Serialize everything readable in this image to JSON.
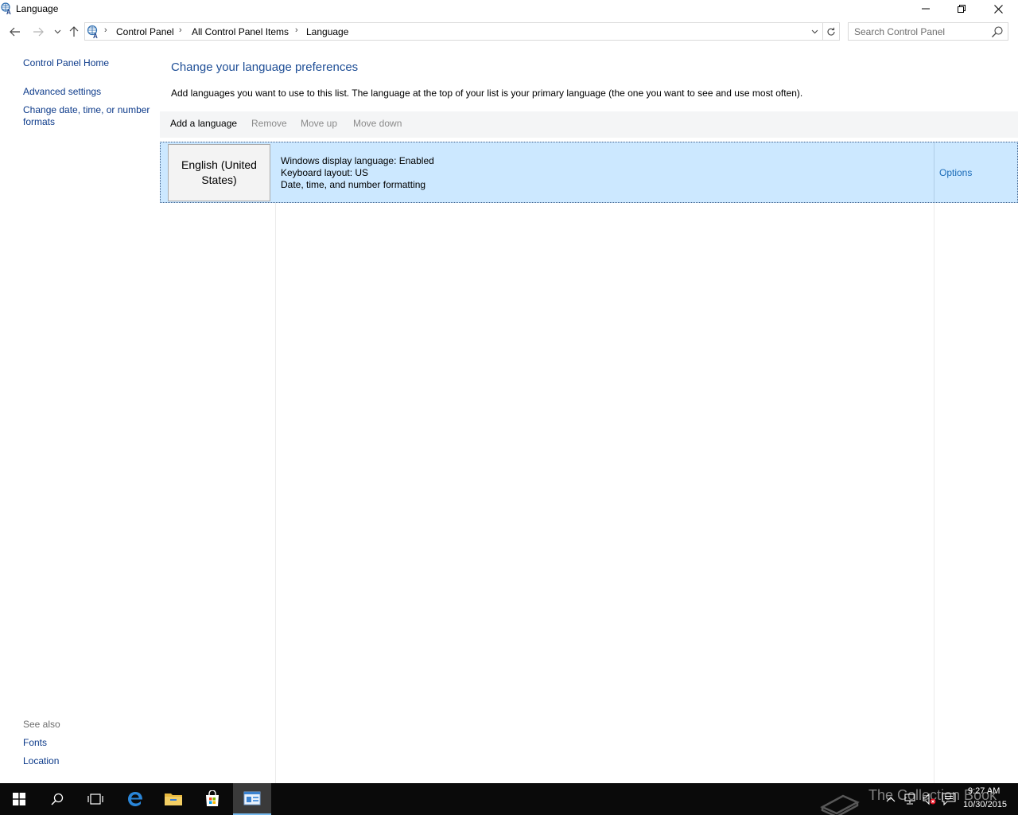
{
  "window": {
    "title": "Language"
  },
  "address": {
    "crumbs": [
      "Control Panel",
      "All Control Panel Items",
      "Language"
    ],
    "search_placeholder": "Search Control Panel"
  },
  "sidebar": {
    "home": "Control Panel Home",
    "advanced_settings": "Advanced settings",
    "change_date": "Change date, time, or number formats",
    "see_also_label": "See also",
    "fonts": "Fonts",
    "location": "Location"
  },
  "main": {
    "heading": "Change your language preferences",
    "description": "Add languages you want to use to this list. The language at the top of your list is your primary language (the one you want to see and use most often).",
    "toolbar": {
      "add": "Add a language",
      "remove": "Remove",
      "move_up": "Move up",
      "move_down": "Move down"
    },
    "languages": [
      {
        "name": "English (United States)",
        "display_language": "Windows display language: Enabled",
        "keyboard_layout": "Keyboard layout: US",
        "formatting": "Date, time, and number formatting",
        "options": "Options"
      }
    ]
  },
  "taskbar": {
    "time": "9:27 AM",
    "date": "10/30/2015",
    "watermark": "The Collection Book"
  },
  "colors": {
    "link": "#0c3a8a",
    "heading": "#1e4e96",
    "selection": "#cce8ff",
    "taskbar": "#0a0a0a"
  }
}
